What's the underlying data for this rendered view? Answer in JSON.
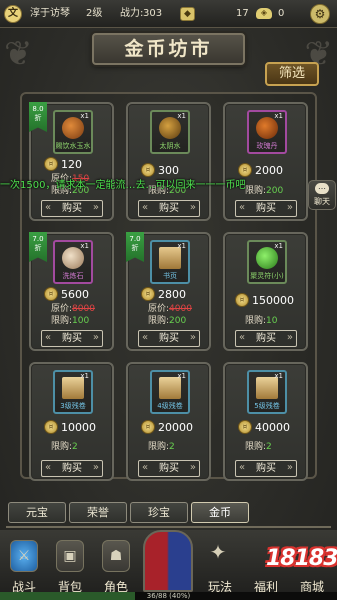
{
  "topbar": {
    "avatar_text": "文",
    "player_name": "淳于访琴",
    "level": "2级",
    "power_label": "战力:",
    "power_value": "303",
    "gold_icon": "gold-ingot-icon",
    "gold_value": "17",
    "ingot_icon": "silver-ingot-icon",
    "ingot_value": "0",
    "settings_icon": "settings-icon"
  },
  "shop": {
    "title": "金币坊市",
    "filter_label": "筛选",
    "buy_label": "购买",
    "original_price_label": "原价:",
    "limit_label": "限购:",
    "discount_suffix": "折"
  },
  "marquee_text": "一次1500，请求本一定能流…去…可以回来一一一币吧",
  "chat_label": "聊天",
  "items": [
    {
      "name": "赐饮水玉水",
      "qty": "x1",
      "price": "120",
      "original_price": "150",
      "limit": "200",
      "discount": "8.0",
      "rarity": "green"
    },
    {
      "name": "太阴水",
      "qty": "x1",
      "price": "300",
      "limit": "200",
      "rarity": "green"
    },
    {
      "name": "玫瑰丹",
      "qty": "x1",
      "price": "2000",
      "limit": "200",
      "rarity": "purple"
    },
    {
      "name": "洗炼石",
      "qty": "x1",
      "price": "5600",
      "original_price": "8000",
      "limit": "100",
      "discount": "7.0",
      "rarity": "purple"
    },
    {
      "name": "书页",
      "qty": "x1",
      "price": "2800",
      "original_price": "4000",
      "limit": "200",
      "discount": "7.0",
      "rarity": "blue"
    },
    {
      "name": "聚灵符(小)",
      "qty": "x1",
      "price": "150000",
      "limit": "10",
      "rarity": "green"
    },
    {
      "name": "3级残卷",
      "qty": "x1",
      "price": "10000",
      "limit": "2",
      "rarity": "blue"
    },
    {
      "name": "4级残卷",
      "qty": "x1",
      "price": "20000",
      "limit": "2",
      "rarity": "blue"
    },
    {
      "name": "5级残卷",
      "qty": "x1",
      "price": "40000",
      "limit": "2",
      "rarity": "blue"
    }
  ],
  "tabs": [
    "元宝",
    "荣誉",
    "珍宝",
    "金币"
  ],
  "active_tab": "金币",
  "nav": [
    "战斗",
    "背包",
    "角色",
    "玩法",
    "福利",
    "商城"
  ],
  "logo_text": "18183",
  "exp_text": "36/88 (40%)",
  "exp_progress": 0.4
}
